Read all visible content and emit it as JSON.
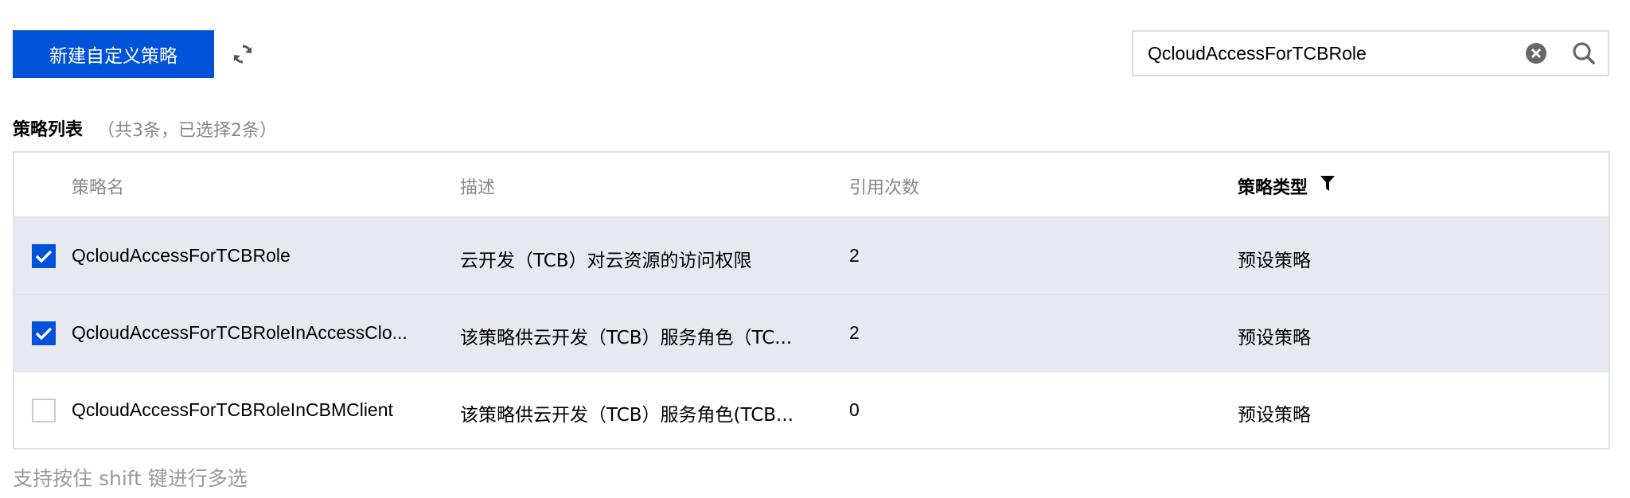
{
  "toolbar": {
    "create_label": "新建自定义策略",
    "refresh_icon": "refresh-icon"
  },
  "search": {
    "value": "QcloudAccessForTCBRole",
    "clear_icon": "clear-icon",
    "search_icon": "search-icon"
  },
  "section": {
    "title": "策略列表",
    "count_text": "（共3条，已选择2条）"
  },
  "table": {
    "columns": [
      "策略名",
      "描述",
      "引用次数",
      "策略类型"
    ],
    "filter_icon": "filter-icon",
    "rows": [
      {
        "checked": true,
        "name": "QcloudAccessForTCBRole",
        "description": "云开发（TCB）对云资源的访问权限",
        "count": "2",
        "type": "预设策略"
      },
      {
        "checked": true,
        "name": "QcloudAccessForTCBRoleInAccessClo...",
        "description": "该策略供云开发（TCB）服务角色（TC...",
        "count": "2",
        "type": "预设策略"
      },
      {
        "checked": false,
        "name": "QcloudAccessForTCBRoleInCBMClient",
        "description": "该策略供云开发（TCB）服务角色(TCB...",
        "count": "0",
        "type": "预设策略"
      }
    ]
  },
  "hint": "支持按住 shift 键进行多选",
  "colors": {
    "primary": "#0052d9",
    "selected_row": "#e6e9ef",
    "muted_text": "#888888"
  }
}
